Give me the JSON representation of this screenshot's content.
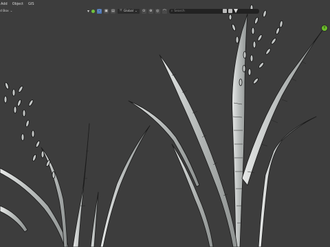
{
  "menu": {
    "items": [
      "Add",
      "Object",
      "GIS"
    ],
    "mode_label": "d Box"
  },
  "toolbar": {
    "transform_orientation": "Global",
    "search_placeholder": "Search"
  },
  "gizmo": {
    "axis_label": "Y"
  },
  "colors": {
    "background": "#3d3d3d",
    "leaf_fill": "#b9bdbc",
    "leaf_edge": "#1a1a1a",
    "active_button": "#4772b3",
    "gizmo_green": "#6cbf2a"
  },
  "icons": [
    "view-icon",
    "green-dot-icon",
    "select-box-icon",
    "search-icon",
    "funnel-icon"
  ]
}
